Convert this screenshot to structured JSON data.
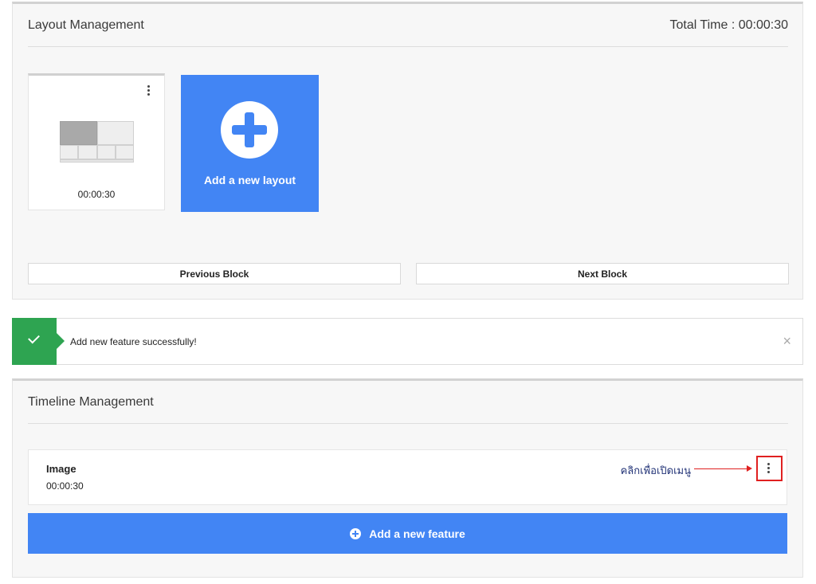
{
  "layout_panel": {
    "title": "Layout Management",
    "total_time": "Total Time : 00:00:30",
    "layouts": [
      {
        "time": "00:00:30",
        "icon": "kebab-menu-icon"
      }
    ],
    "add_layout_label": "Add a new layout",
    "add_layout_icon": "plus-circle-icon",
    "previous_label": "Previous Block",
    "next_label": "Next Block"
  },
  "notification": {
    "message": "Add new feature successfully!",
    "status_icon": "check-icon",
    "close_icon": "close-icon",
    "close_glyph": "×",
    "status_color": "#2ea451"
  },
  "timeline_panel": {
    "title": "Timeline Management",
    "features": [
      {
        "name": "Image",
        "time": "00:00:30",
        "menu_icon": "kebab-menu-icon"
      }
    ],
    "annotation": "คลิกเพื่อเปิดเมนู",
    "add_feature_label": "Add a new feature",
    "add_feature_icon": "plus-circle-icon"
  },
  "colors": {
    "accent": "#4285f4",
    "annotation_red": "#e02020",
    "success": "#2ea451"
  }
}
